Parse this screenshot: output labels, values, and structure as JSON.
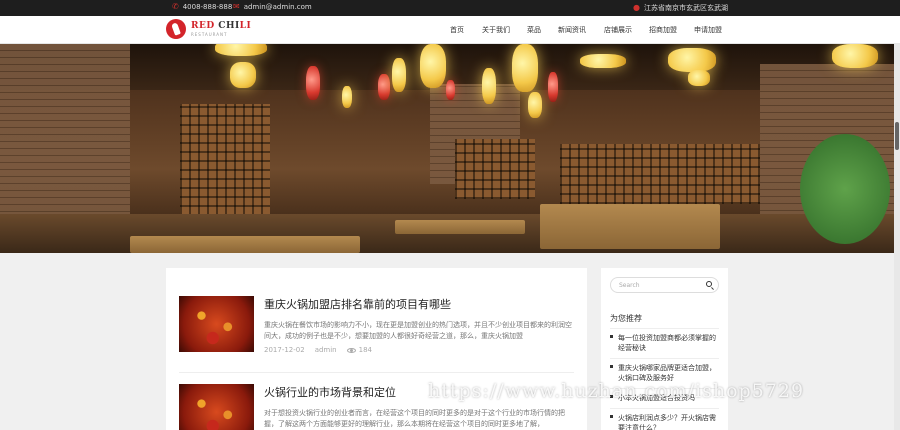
{
  "topbar": {
    "phone": "4008-888-888",
    "email": "admin@admin.com",
    "address": "江苏省南京市玄武区玄武湖",
    "phone_icon": "phone-icon",
    "email_icon": "mail-icon",
    "address_icon": "location-pin-icon"
  },
  "logo": {
    "main_a": "RED ",
    "main_b": "CHI",
    "main_c": "LI",
    "sub": "RESTAURANT"
  },
  "nav": [
    "首页",
    "关于我们",
    "菜品",
    "新闻资讯",
    "店铺展示",
    "招商加盟",
    "申请加盟"
  ],
  "posts": [
    {
      "title": "重庆火锅加盟店排名靠前的项目有哪些",
      "excerpt": "重庆火锅在餐饮市场的影响力不小，现在更是加盟创业的热门选项，并且不少创业项目都来的利润空间大，成功的例子也是不少，想要加盟的人都很好奇经营之道，那么，重庆火锅加盟",
      "date": "2017-12-02",
      "author": "admin",
      "views": "184"
    },
    {
      "title": "火锅行业的市场背景和定位",
      "excerpt": "对于想投资火锅行业的创业者而言，在经营这个项目的同时更多的是对于这个行业的市场行情的把握，了解这两个方面能够更好的理解行业，那么本期将在经营这个项目的同时更多地了解，",
      "date": "",
      "author": "",
      "views": ""
    }
  ],
  "sidebar": {
    "search_placeholder": "Search",
    "title": "为您推荐",
    "recommendations": [
      "每一位投资加盟商都必须掌握的经营秘诀",
      "重庆火锅哪家品牌更适合加盟，火锅口碑及服务好",
      "小本火锅加盟适合投资吗",
      "火锅店利润点多少？开火锅店需要注意什么？"
    ]
  },
  "watermark": "https://www.huzhan.com/ishop5729"
}
